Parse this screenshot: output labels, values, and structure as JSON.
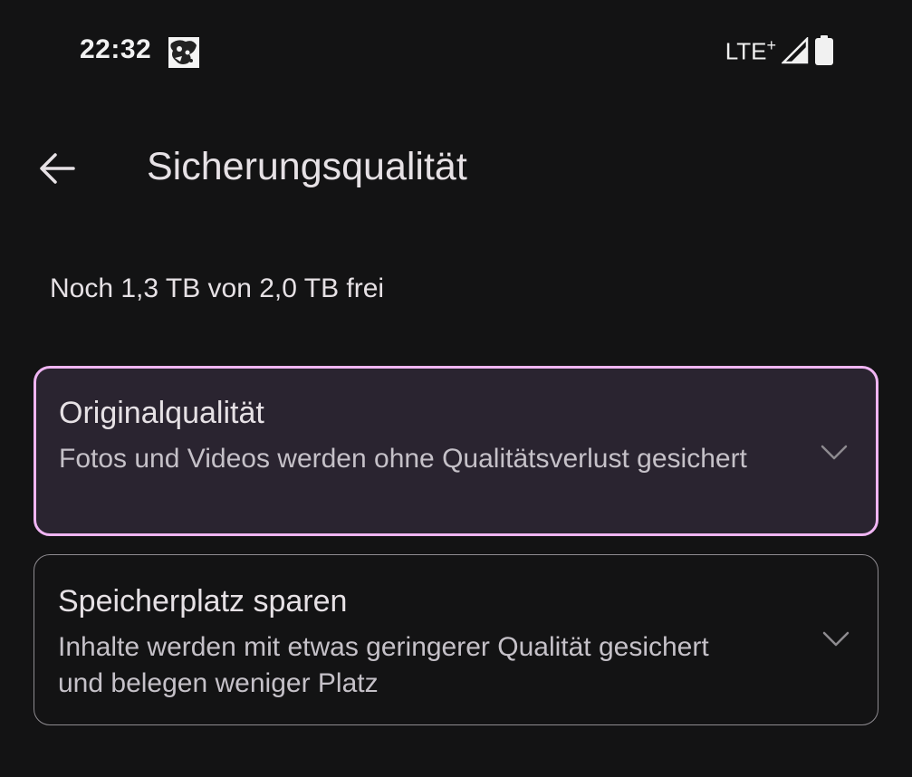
{
  "status_bar": {
    "time": "22:32",
    "network": "LTE",
    "network_plus": "+",
    "notification_icon": "photo-thumbnail-icon",
    "signal_icon": "signal-icon",
    "battery_icon": "battery-icon"
  },
  "app_bar": {
    "back_icon": "arrow-back-icon",
    "title": "Sicherungsqualität"
  },
  "storage": {
    "text": "Noch 1,3 TB von 2,0 TB frei"
  },
  "options": [
    {
      "title": "Originalqualität",
      "description": "Fotos und Videos werden ohne Qualitätsverlust gesichert",
      "selected": true,
      "icon": "chevron-down-icon"
    },
    {
      "title": "Speicherplatz sparen",
      "description": "Inhalte werden mit etwas geringerer Qualität gesichert und belegen weniger Platz",
      "selected": false,
      "icon": "chevron-down-icon"
    }
  ],
  "colors": {
    "background": "#131314",
    "accent": "#f0b5f3",
    "selected_card": "#2a2430",
    "border": "#8e8b90"
  }
}
